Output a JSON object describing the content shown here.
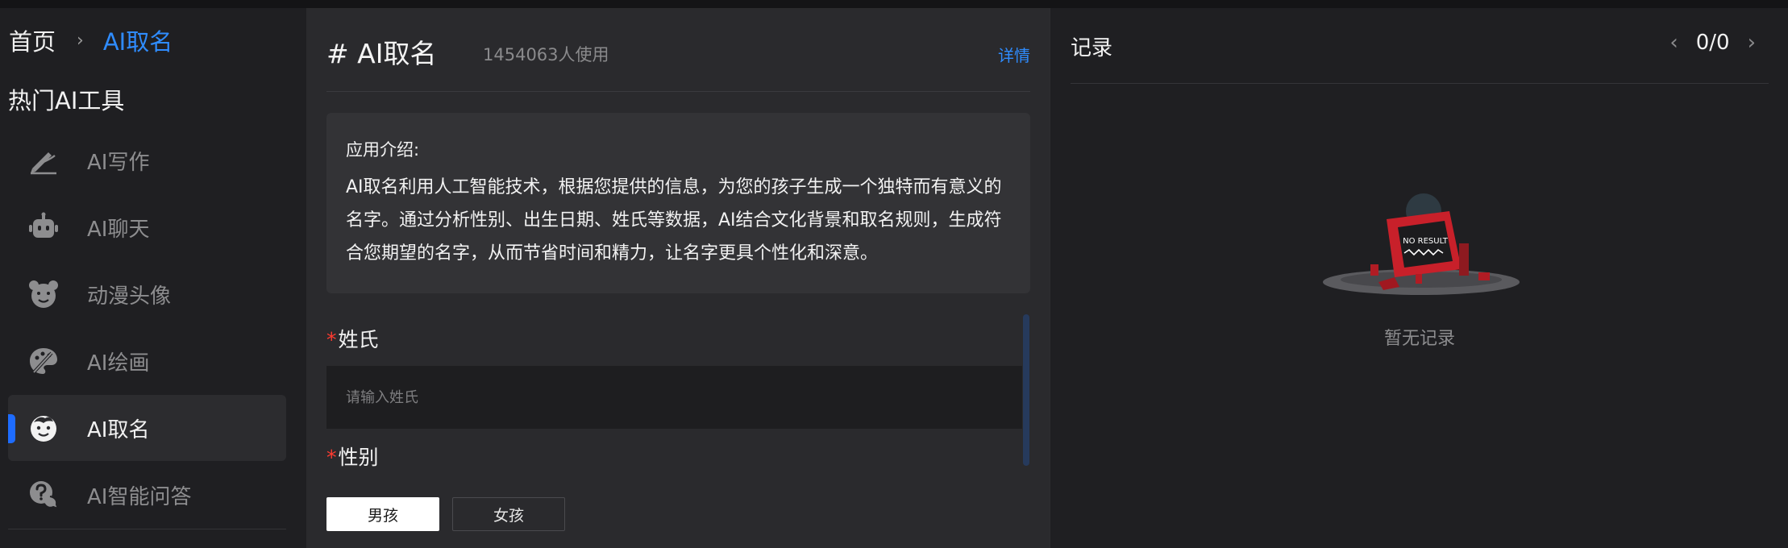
{
  "breadcrumb": {
    "home": "首页",
    "separator": "›",
    "current": "AI取名"
  },
  "sidebar": {
    "section_title": "热门AI工具",
    "items": [
      {
        "label": "AI写作",
        "icon": "pen-icon",
        "active": false
      },
      {
        "label": "AI聊天",
        "icon": "robot-icon",
        "active": false
      },
      {
        "label": "动漫头像",
        "icon": "bear-icon",
        "active": false
      },
      {
        "label": "AI绘画",
        "icon": "palette-icon",
        "active": false
      },
      {
        "label": "AI取名",
        "icon": "baby-face-icon",
        "active": true
      },
      {
        "label": "AI智能问答",
        "icon": "question-bubble-icon",
        "active": false
      }
    ]
  },
  "main": {
    "title": "# AI取名",
    "usage": "1454063人使用",
    "details_link": "详情",
    "intro": {
      "title": "应用介绍:",
      "text": "AI取名利用人工智能技术，根据您提供的信息，为您的孩子生成一个独特而有意义的名字。通过分析性别、出生日期、姓氏等数据，AI结合文化背景和取名规则，生成符合您期望的名字，从而节省时间和精力，让名字更具个性化和深意。"
    },
    "form": {
      "surname_label": "姓氏",
      "surname_placeholder": "请输入姓氏",
      "surname_value": "",
      "gender_label": "性别",
      "required_mark": "*",
      "gender_options": [
        "男孩",
        "女孩"
      ],
      "gender_selected": "男孩"
    }
  },
  "records": {
    "title": "记录",
    "prev": "‹",
    "next": "›",
    "count": "0/0",
    "empty_image_text": "NO RESULT",
    "empty_text": "暂无记录"
  },
  "colors": {
    "accent": "#2f8cff",
    "active_indicator": "#1e6cff",
    "required": "#ff3b30"
  }
}
